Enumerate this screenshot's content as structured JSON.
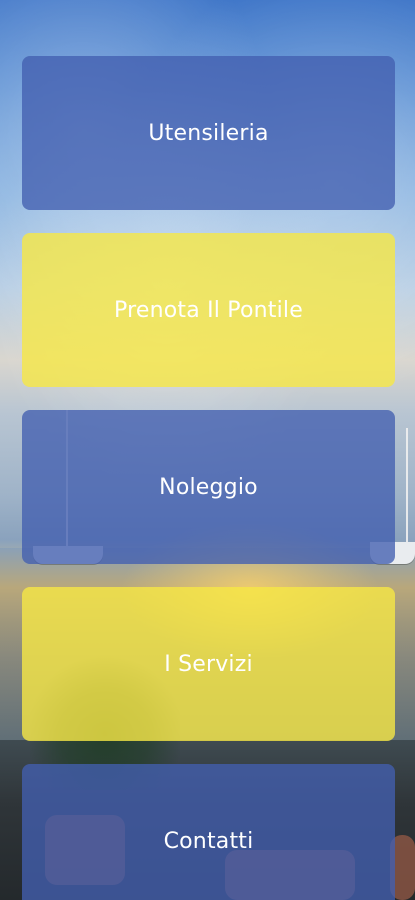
{
  "menu": {
    "items": [
      {
        "label": "Utensileria",
        "color": "#425FB0"
      },
      {
        "label": "Prenota Il Pontile",
        "color": "#F6E745"
      },
      {
        "label": "Noleggio",
        "color": "#425FB0"
      },
      {
        "label": "I Servizi",
        "color": "#F6E745"
      },
      {
        "label": "Contatti",
        "color": "#425FB0"
      }
    ]
  }
}
